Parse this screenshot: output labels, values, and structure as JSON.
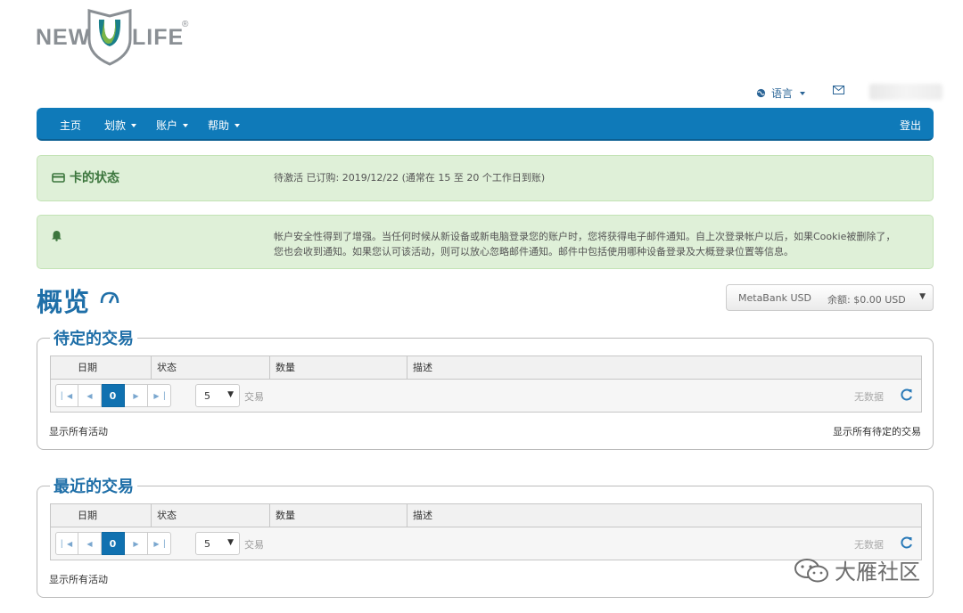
{
  "logo": {
    "left": "NEW",
    "right": "LIFE",
    "reg": "®",
    "brand_green": "#7ab648",
    "brand_teal": "#1a7f8a"
  },
  "utility": {
    "language_label": "语言",
    "globe_icon": "globe-icon",
    "mail_icon": "envelope-icon"
  },
  "nav": {
    "items": [
      {
        "label": "主页",
        "has_caret": false
      },
      {
        "label": "划款",
        "has_caret": true
      },
      {
        "label": "账户",
        "has_caret": true
      },
      {
        "label": "帮助",
        "has_caret": true
      }
    ],
    "logout": "登出",
    "color": "#0f7ab9"
  },
  "card_status": {
    "title": "卡的状态",
    "text": "待激活 已订购: 2019/12/22 (通常在 15 至 20 个工作日到账)"
  },
  "security_notice": {
    "line1": "帐户安全性得到了增强。当任何时候从新设备或新电脑登录您的账户时，您将获得电子邮件通知。自上次登录帐户以后，如果Cookie被删除了，",
    "line2": "您也会收到通知。如果您认可该活动，则可以放心忽略邮件通知。邮件中包括使用哪种设备登录及大概登录位置等信息。"
  },
  "overview": {
    "title": "概览",
    "account": {
      "name": "MetaBank USD",
      "balance": "余额: $0.00 USD"
    }
  },
  "pending": {
    "legend": "待定的交易",
    "columns": [
      "日期",
      "状态",
      "数量",
      "描述"
    ],
    "current_page": "0",
    "page_size": "5",
    "page_size_label": "交易",
    "no_data": "无数据",
    "show_all": "显示所有活动",
    "show_pending": "显示所有待定的交易"
  },
  "recent": {
    "legend": "最近的交易",
    "columns": [
      "日期",
      "状态",
      "数量",
      "描述"
    ],
    "current_page": "0",
    "page_size": "5",
    "page_size_label": "交易",
    "no_data": "无数据",
    "show_all": "显示所有活动"
  },
  "watermark": {
    "text": "大雁社区"
  }
}
